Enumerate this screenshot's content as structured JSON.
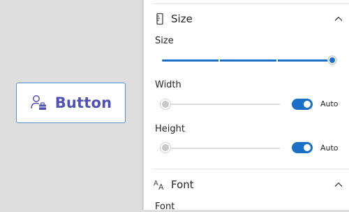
{
  "preview": {
    "button_label": "Button",
    "button_icon": "person-toolbox-icon"
  },
  "size_section": {
    "title": "Size",
    "icon": "ruler-icon",
    "collapse_icon": "chevron-up-icon",
    "size_label": "Size",
    "size_value_fraction": 1.0,
    "width_label": "Width",
    "width_auto_label": "Auto",
    "width_auto_on": true,
    "width_value_fraction": 0.0,
    "height_label": "Height",
    "height_auto_label": "Auto",
    "height_auto_on": true,
    "height_value_fraction": 0.0
  },
  "font_section": {
    "title": "Font",
    "icon": "text-font-size-icon",
    "collapse_icon": "chevron-up-icon",
    "font_label": "Font"
  },
  "colors": {
    "accent": "#1a70c6",
    "button_text": "#4f52b2",
    "button_border": "#5b8ed0"
  }
}
